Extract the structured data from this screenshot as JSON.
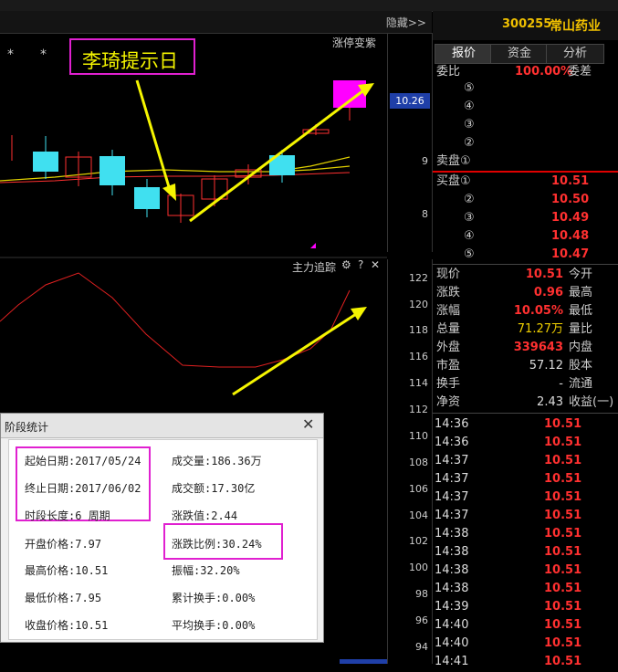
{
  "header": {
    "hide_label": "隐藏>>",
    "stock_code": "300255",
    "stock_name": "常山药业"
  },
  "tabs": [
    "报价",
    "资金",
    "分析"
  ],
  "order_book": {
    "weibi_label": "委比",
    "weibi_value": "100.00%",
    "weicha_label": "委差",
    "sell_levels": [
      "⑤",
      "④",
      "③",
      "②"
    ],
    "sell_label": "卖盘①",
    "buy_label": "买盘①",
    "buy_levels": [
      {
        "level": "",
        "price": "10.51"
      },
      {
        "level": "②",
        "price": "10.50"
      },
      {
        "level": "③",
        "price": "10.49"
      },
      {
        "level": "④",
        "price": "10.48"
      },
      {
        "level": "⑤",
        "price": "10.47"
      }
    ]
  },
  "quote": {
    "rows": [
      {
        "l1": "现价",
        "v1": "10.51",
        "l2": "今开",
        "c": "red"
      },
      {
        "l1": "涨跌",
        "v1": "0.96",
        "l2": "最高",
        "c": "red"
      },
      {
        "l1": "涨幅",
        "v1": "10.05%",
        "l2": "最低",
        "c": "red"
      },
      {
        "l1": "总量",
        "v1": "71.27万",
        "l2": "量比",
        "c": "yel"
      },
      {
        "l1": "外盘",
        "v1": "339643",
        "l2": "内盘",
        "c": "red"
      },
      {
        "l1": "市盈",
        "v1": "57.12",
        "l2": "股本",
        "c": "wht"
      },
      {
        "l1": "换手",
        "v1": "-",
        "l2": "流通",
        "c": "wht"
      },
      {
        "l1": "净资",
        "v1": "2.43",
        "l2": "收益(一)",
        "c": "wht"
      }
    ]
  },
  "ticks": [
    {
      "time": "14:36",
      "price": "10.51"
    },
    {
      "time": "14:36",
      "price": "10.51"
    },
    {
      "time": "14:37",
      "price": "10.51"
    },
    {
      "time": "14:37",
      "price": "10.51"
    },
    {
      "time": "14:37",
      "price": "10.51"
    },
    {
      "time": "14:37",
      "price": "10.51"
    },
    {
      "time": "14:38",
      "price": "10.51"
    },
    {
      "time": "14:38",
      "price": "10.51"
    },
    {
      "time": "14:38",
      "price": "10.51"
    },
    {
      "time": "14:38",
      "price": "10.51"
    },
    {
      "time": "14:39",
      "price": "10.51"
    },
    {
      "time": "14:40",
      "price": "10.51"
    },
    {
      "time": "14:40",
      "price": "10.51"
    },
    {
      "time": "14:41",
      "price": "10.51"
    }
  ],
  "chart": {
    "annotation": "李琦提示日",
    "top_label": "涨停变紫",
    "price_badge": "10.26",
    "price_ticks": [
      "9",
      "8"
    ],
    "stars": [
      "*",
      "*"
    ],
    "indicator_label": "主力追踪",
    "indicator_icons": [
      "⚙",
      "?",
      "✕"
    ],
    "indicator_ticks": [
      "122",
      "120",
      "118",
      "116",
      "114",
      "112",
      "110",
      "108",
      "106",
      "104",
      "102",
      "100",
      "98",
      "96",
      "94"
    ]
  },
  "dialog": {
    "title": "阶段统计",
    "start": "起始日期:2017/05/24",
    "end": "终止日期:2017/06/02",
    "length": "时段长度:6 周期",
    "open": "开盘价格:7.97",
    "high": "最高价格:10.51",
    "low": "最低价格:7.95",
    "close": "收盘价格:10.51",
    "volume": "成交量:186.36万",
    "amount": "成交额:17.30亿",
    "change": "涨跌值:2.44",
    "change_pct": "涨跌比例:30.24%",
    "amplitude": "振幅:32.20%",
    "turnover_total": "累计换手:0.00%",
    "turnover_avg": "平均换手:0.00%"
  }
}
